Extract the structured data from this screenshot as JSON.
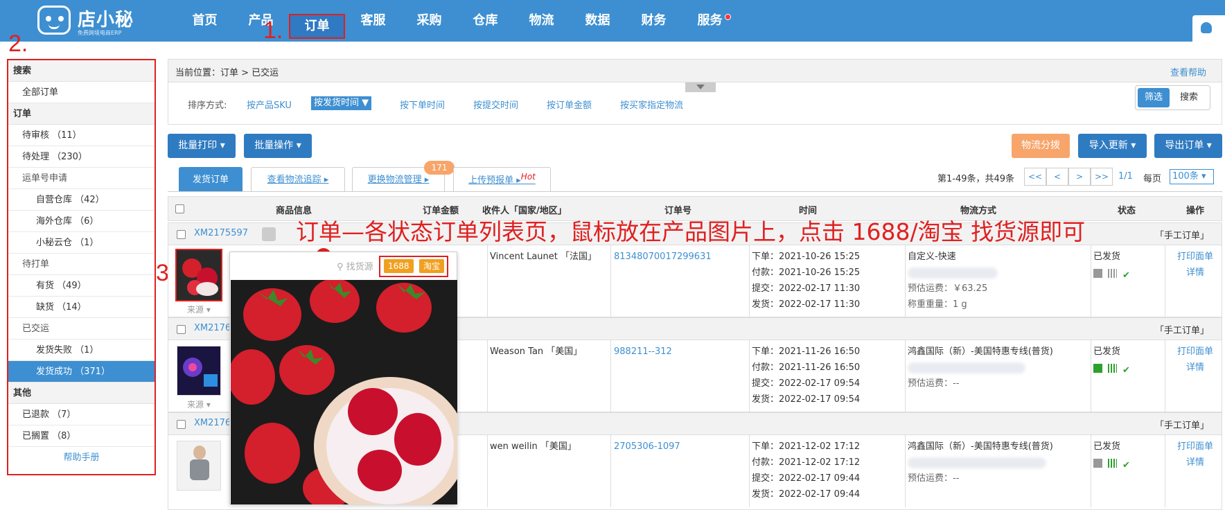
{
  "logo": {
    "name": "店小秘",
    "sub": "免费跨境电商ERP"
  },
  "nav": [
    "首页",
    "产品",
    "订单",
    "客服",
    "采购",
    "仓库",
    "物流",
    "数据",
    "财务",
    "服务"
  ],
  "annotations": {
    "a1": "1.",
    "a2": "2.",
    "a3": "3.",
    "a4": "4.",
    "note": "订单—各状态订单列表页，鼠标放在产品图片上，点击 1688/淘宝 找货源即可"
  },
  "sidebar": {
    "search_section": "搜索",
    "all_orders": "全部订单",
    "order_section": "订单",
    "items": [
      {
        "label": "待审核 （11）"
      },
      {
        "label": "待处理 （230）"
      },
      {
        "label": "运单号申请"
      },
      {
        "label": "自营仓库 （42）"
      },
      {
        "label": "海外仓库 （6）"
      },
      {
        "label": "小秘云仓 （1）"
      },
      {
        "label": "待打单"
      },
      {
        "label": "有货 （49）"
      },
      {
        "label": "缺货 （14）"
      },
      {
        "label": "已交运"
      },
      {
        "label": "发货失败 （1）"
      },
      {
        "label": "发货成功 （371）"
      }
    ],
    "other_section": "其他",
    "other_items": [
      {
        "label": "已退款 （7）"
      },
      {
        "label": "已搁置 （8）"
      }
    ],
    "help": "帮助手册"
  },
  "breadcrumb": {
    "label": "当前位置：",
    "path": "订单 > 已交运",
    "help": "查看帮助"
  },
  "sort": {
    "label": "排序方式:",
    "options": [
      "按产品SKU",
      "按发货时间 ▼",
      "按下单时间",
      "按提交时间",
      "按订单金额",
      "按买家指定物流"
    ],
    "filter": "筛选",
    "search": "搜索"
  },
  "actions": {
    "batch_print": "批量打印 ▾",
    "batch_ops": "批量操作 ▾",
    "logistics": "物流分拨",
    "import": "导入更新 ▾",
    "export": "导出订单 ▾"
  },
  "tabs": [
    {
      "label": "发货订单"
    },
    {
      "label": "查看物流追踪 ▸"
    },
    {
      "label": "更换物流管理 ▸"
    },
    {
      "label": "上传预报单 ▸",
      "hot": "Hot"
    }
  ],
  "tab_badge": "171",
  "pager": {
    "count": "第1-49条，共49条",
    "first": "<<",
    "prev": "<",
    "next": ">",
    "last": ">>",
    "page": "1/1",
    "per_label": "每页",
    "per": "100条 ▾"
  },
  "columns": [
    "商品信息",
    "订单金额",
    "收件人「国家/地区」",
    "订单号",
    "时间",
    "物流方式",
    "状态",
    "操作"
  ],
  "orders": [
    {
      "id": "XM2175597",
      "tag": "「手工订单」",
      "recipient": "Vincent Launet 「法国」",
      "order_no": "81348070017299631",
      "times": [
        "下单：2021-10-26 15:25",
        "付款：2021-10-26 15:25",
        "提交：2022-02-17 11:30",
        "发货：2022-02-17 11:30"
      ],
      "logistics": [
        "自定义-快速",
        "",
        "预估运费：￥63.25",
        "称重重量：1 g"
      ],
      "status": "已发货",
      "op1": "打印面单",
      "op2": "详情",
      "src": "来源 ▾"
    },
    {
      "id": "XM2176",
      "tag": "「手工订单」",
      "recipient": "Weason Tan 「美国」",
      "order_no": "988211--312",
      "times": [
        "下单：2021-11-26 16:50",
        "付款：2021-11-26 16:50",
        "提交：2022-02-17 09:54",
        "发货：2022-02-17 09:54"
      ],
      "logistics": [
        "鸿鑫国际（新）-美国特惠专线(普货)",
        "",
        "预估运费：--",
        ""
      ],
      "status": "已发货",
      "op1": "打印面单",
      "op2": "详情",
      "src": "来源 ▾"
    },
    {
      "id": "XM2176",
      "tag": "「手工订单」",
      "recipient": "wen weilin 「美国」",
      "order_no": "2705306-1097",
      "times": [
        "下单：2021-12-02 17:12",
        "付款：2021-12-02 17:12",
        "提交：2022-02-17 09:44",
        "发货：2022-02-17 09:44"
      ],
      "logistics": [
        "鸿鑫国际（新）-美国特惠专线(普货)",
        "",
        "预估运费：--",
        ""
      ],
      "status": "已发货",
      "op1": "打印面单",
      "op2": "详情"
    }
  ],
  "popup": {
    "search": "找货源",
    "b1688": "1688",
    "btaobao": "淘宝"
  },
  "colors": {
    "primary": "#3d8fd1",
    "orange": "#f7a56a",
    "annotation": "#e02020"
  }
}
